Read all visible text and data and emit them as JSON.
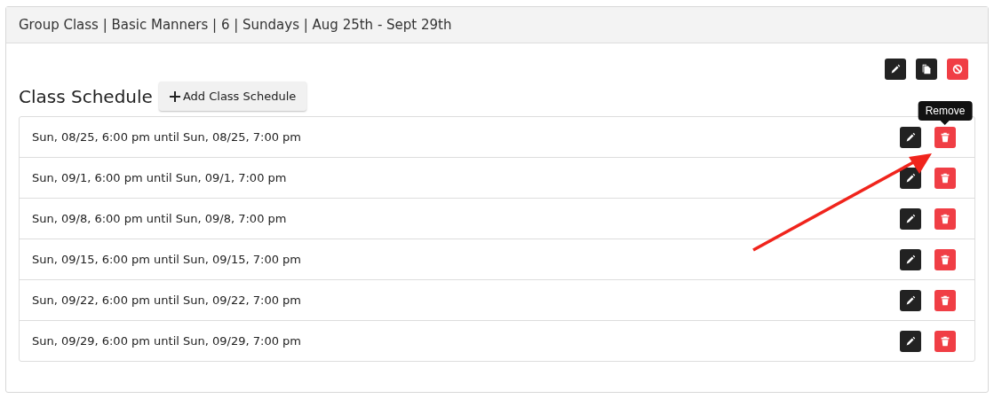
{
  "panel": {
    "title": "Group Class | Basic Manners | 6 | Sundays | Aug 25th - Sept 29th"
  },
  "toolbar": [
    {
      "kind": "edit"
    },
    {
      "kind": "copy"
    },
    {
      "kind": "disable"
    }
  ],
  "section": {
    "title": "Class Schedule",
    "add_button": "Add Class Schedule"
  },
  "schedule": [
    {
      "text": "Sun, 08/25, 6:00 pm until Sun, 08/25, 7:00 pm",
      "tooltip": "Remove"
    },
    {
      "text": "Sun, 09/1, 6:00 pm until Sun, 09/1, 7:00 pm"
    },
    {
      "text": "Sun, 09/8, 6:00 pm until Sun, 09/8, 7:00 pm"
    },
    {
      "text": "Sun, 09/15, 6:00 pm until Sun, 09/15, 7:00 pm"
    },
    {
      "text": "Sun, 09/22, 6:00 pm until Sun, 09/22, 7:00 pm"
    },
    {
      "text": "Sun, 09/29, 6:00 pm until Sun, 09/29, 7:00 pm"
    }
  ]
}
